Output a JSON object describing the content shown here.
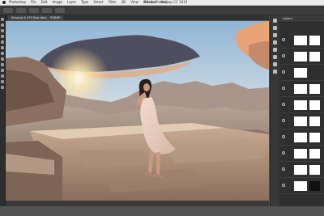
{
  "menubar": {
    "items": [
      "Photoshop",
      "File",
      "Edit",
      "Image",
      "Layer",
      "Type",
      "Select",
      "Filter",
      "3D",
      "View",
      "Window",
      "Help"
    ],
    "window_title": "Adobe Photoshop CC 2019"
  },
  "tab": {
    "label": "Shaping & VFX flow dark... RGB/8*"
  },
  "layers_panel": {
    "title": "Layers"
  }
}
